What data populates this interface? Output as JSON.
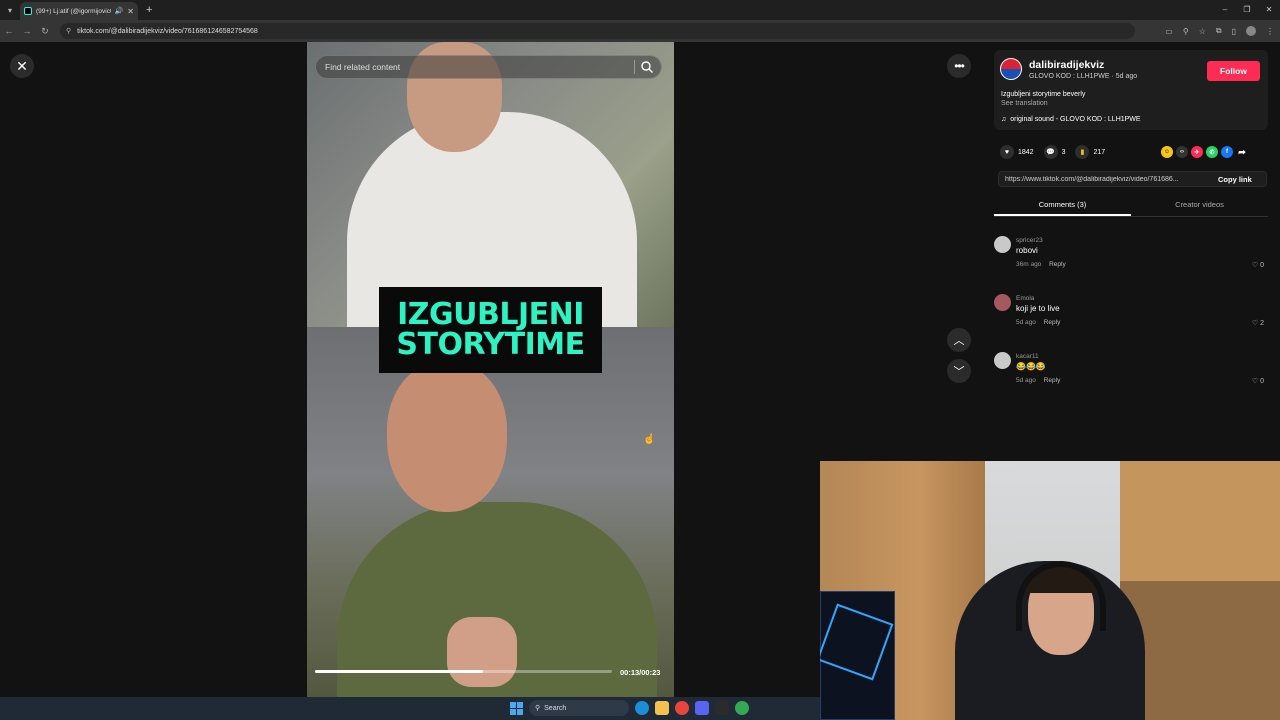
{
  "browser": {
    "tab_title": "(99+) Lj:atif (@igormijovic0:",
    "url": "tiktok.com/@dalibiradijekviz/video/7616861246582754568"
  },
  "search": {
    "placeholder": "Find related content"
  },
  "video": {
    "overlay_line1": "IZGUBLJENI",
    "overlay_line2": "STORYTIME",
    "time": "00:13/00:23",
    "progress": 0.565
  },
  "creator": {
    "username": "dalibiradijekviz",
    "subline": "GLOVO KOD : LLH1PWE · 5d ago",
    "follow_label": "Follow",
    "description": "Izgubljeni storytime beverly",
    "see_translation": "See translation",
    "sound": "original sound - GLOVO KOD : LLH1PWE"
  },
  "stats": {
    "likes": "1842",
    "comments": "3",
    "saves": "217"
  },
  "share_icons": [
    "repost-icon",
    "embed-icon",
    "twitter-icon",
    "whatsapp-icon",
    "facebook-icon",
    "share-arrow-icon"
  ],
  "link": {
    "url": "https://www.tiktok.com/@dalibiradijekviz/video/761686...",
    "copy_label": "Copy link"
  },
  "tabs": {
    "comments": "Comments (3)",
    "creator_videos": "Creator videos"
  },
  "comments": [
    {
      "user": "spricer23",
      "text": "robovi",
      "time": "36m ago",
      "reply": "Reply",
      "likes": "0"
    },
    {
      "user": "Emola",
      "text": "koji je to live",
      "time": "5d ago",
      "reply": "Reply",
      "likes": "2"
    },
    {
      "user": "kacar11",
      "text": "😂😂😂",
      "time": "5d ago",
      "reply": "Reply",
      "likes": "0"
    }
  ],
  "taskbar": {
    "search_label": "Search"
  },
  "colors": {
    "follow": "#fe2c55",
    "overlay_text": "#2ef2c2",
    "page_bg": "#121212"
  }
}
